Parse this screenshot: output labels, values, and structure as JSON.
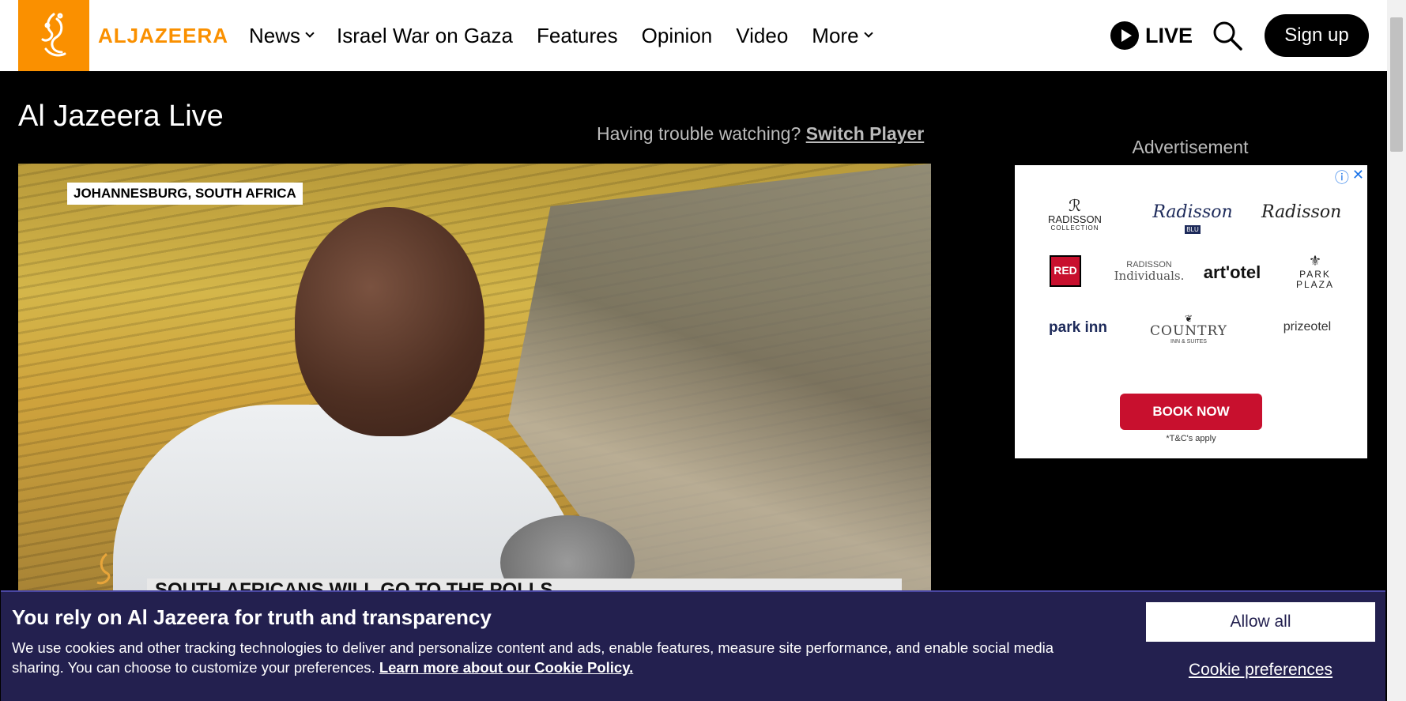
{
  "header": {
    "logo_text": "ALJAZEERA",
    "nav": [
      {
        "label": "News",
        "has_dropdown": true
      },
      {
        "label": "Israel War on Gaza",
        "has_dropdown": false
      },
      {
        "label": "Features",
        "has_dropdown": false
      },
      {
        "label": "Opinion",
        "has_dropdown": false
      },
      {
        "label": "Video",
        "has_dropdown": false
      },
      {
        "label": "More",
        "has_dropdown": true
      }
    ],
    "live_label": "LIVE",
    "signup_label": "Sign up"
  },
  "main": {
    "title": "Al Jazeera Live",
    "trouble_text": "Having trouble watching?",
    "switch_player": "Switch Player"
  },
  "video": {
    "location_tag": "JOHANNESBURG, SOUTH AFRICA",
    "lower_third": "SOUTH AFRICANS WILL GO TO THE POLLS"
  },
  "ad": {
    "label": "Advertisement",
    "brands": {
      "radisson_collection": "RADISSON",
      "radisson_collection_sub": "COLLECTION",
      "radisson_blu": "Radisson",
      "radisson_blu_tag": "BLU",
      "radisson": "Radisson",
      "red": "RED",
      "individuals_top": "RADISSON",
      "individuals": "Individuals.",
      "artotel": "art'otel",
      "park_plaza_1": "PARK",
      "park_plaza_2": "PLAZA",
      "park_inn": "park inn",
      "country": "COUNTRY",
      "country_sub": "INN & SUITES",
      "prizeotel": "prizeotel"
    },
    "cta": "BOOK NOW",
    "terms": "*T&C's apply"
  },
  "cookie": {
    "title": "You rely on Al Jazeera for truth and transparency",
    "body": "We use cookies and other tracking technologies to deliver and personalize content and ads, enable features, measure site performance, and enable social media sharing. You can choose to customize your preferences.",
    "policy_link": "Learn more about our Cookie Policy.",
    "allow_all": "Allow all",
    "preferences": "Cookie preferences"
  },
  "colors": {
    "brand_orange": "#fa9000",
    "cookie_bg": "#23204f",
    "ad_red": "#c8102e"
  }
}
